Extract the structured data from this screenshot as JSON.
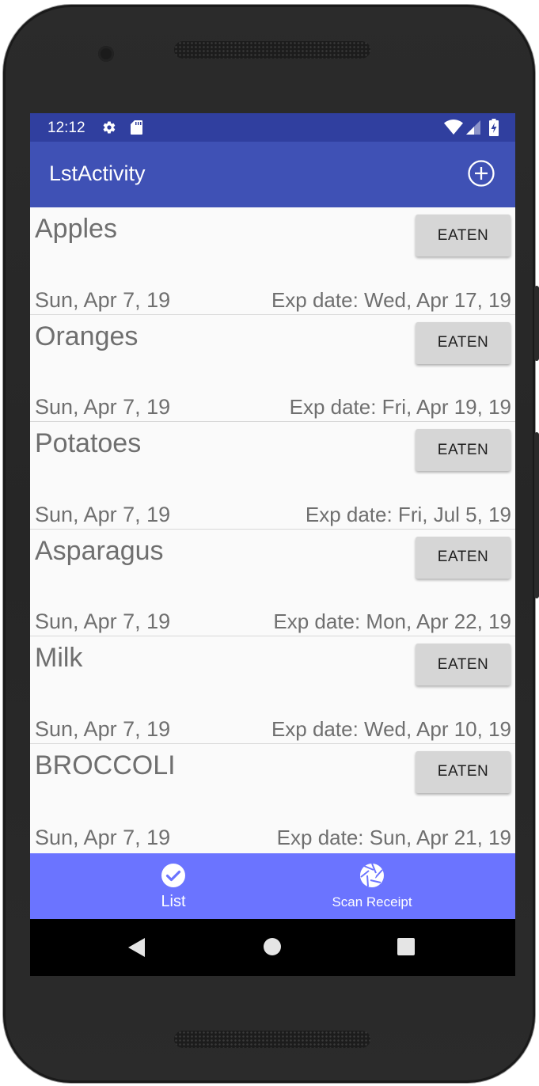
{
  "status_bar": {
    "time": "12:12"
  },
  "app_bar": {
    "title": "LstActivity",
    "action_icon": "add-circle-icon"
  },
  "items": [
    {
      "name": "Apples",
      "button": "EATEN",
      "date": "Sun, Apr 7, 19",
      "exp": "Exp date: Wed, Apr 17, 19"
    },
    {
      "name": "Oranges",
      "button": "EATEN",
      "date": "Sun, Apr 7, 19",
      "exp": "Exp date: Fri, Apr 19, 19"
    },
    {
      "name": "Potatoes",
      "button": "EATEN",
      "date": "Sun, Apr 7, 19",
      "exp": "Exp date: Fri, Jul 5, 19"
    },
    {
      "name": "Asparagus",
      "button": "EATEN",
      "date": "Sun, Apr 7, 19",
      "exp": "Exp date: Mon, Apr 22, 19"
    },
    {
      "name": "Milk",
      "button": "EATEN",
      "date": "Sun, Apr 7, 19",
      "exp": "Exp date: Wed, Apr 10, 19"
    },
    {
      "name": "BROCCOLI",
      "button": "EATEN",
      "date": "Sun, Apr 7, 19",
      "exp": "Exp date: Sun, Apr 21, 19"
    }
  ],
  "bottom_nav": {
    "list": {
      "label": "List",
      "icon": "check-circle-icon"
    },
    "scan": {
      "label": "Scan Receipt",
      "icon": "camera-shutter-icon"
    }
  },
  "colors": {
    "status_bar": "#303f9f",
    "app_bar": "#3f51b5",
    "bottom_nav": "#6b74ff",
    "button": "#d6d6d6"
  }
}
